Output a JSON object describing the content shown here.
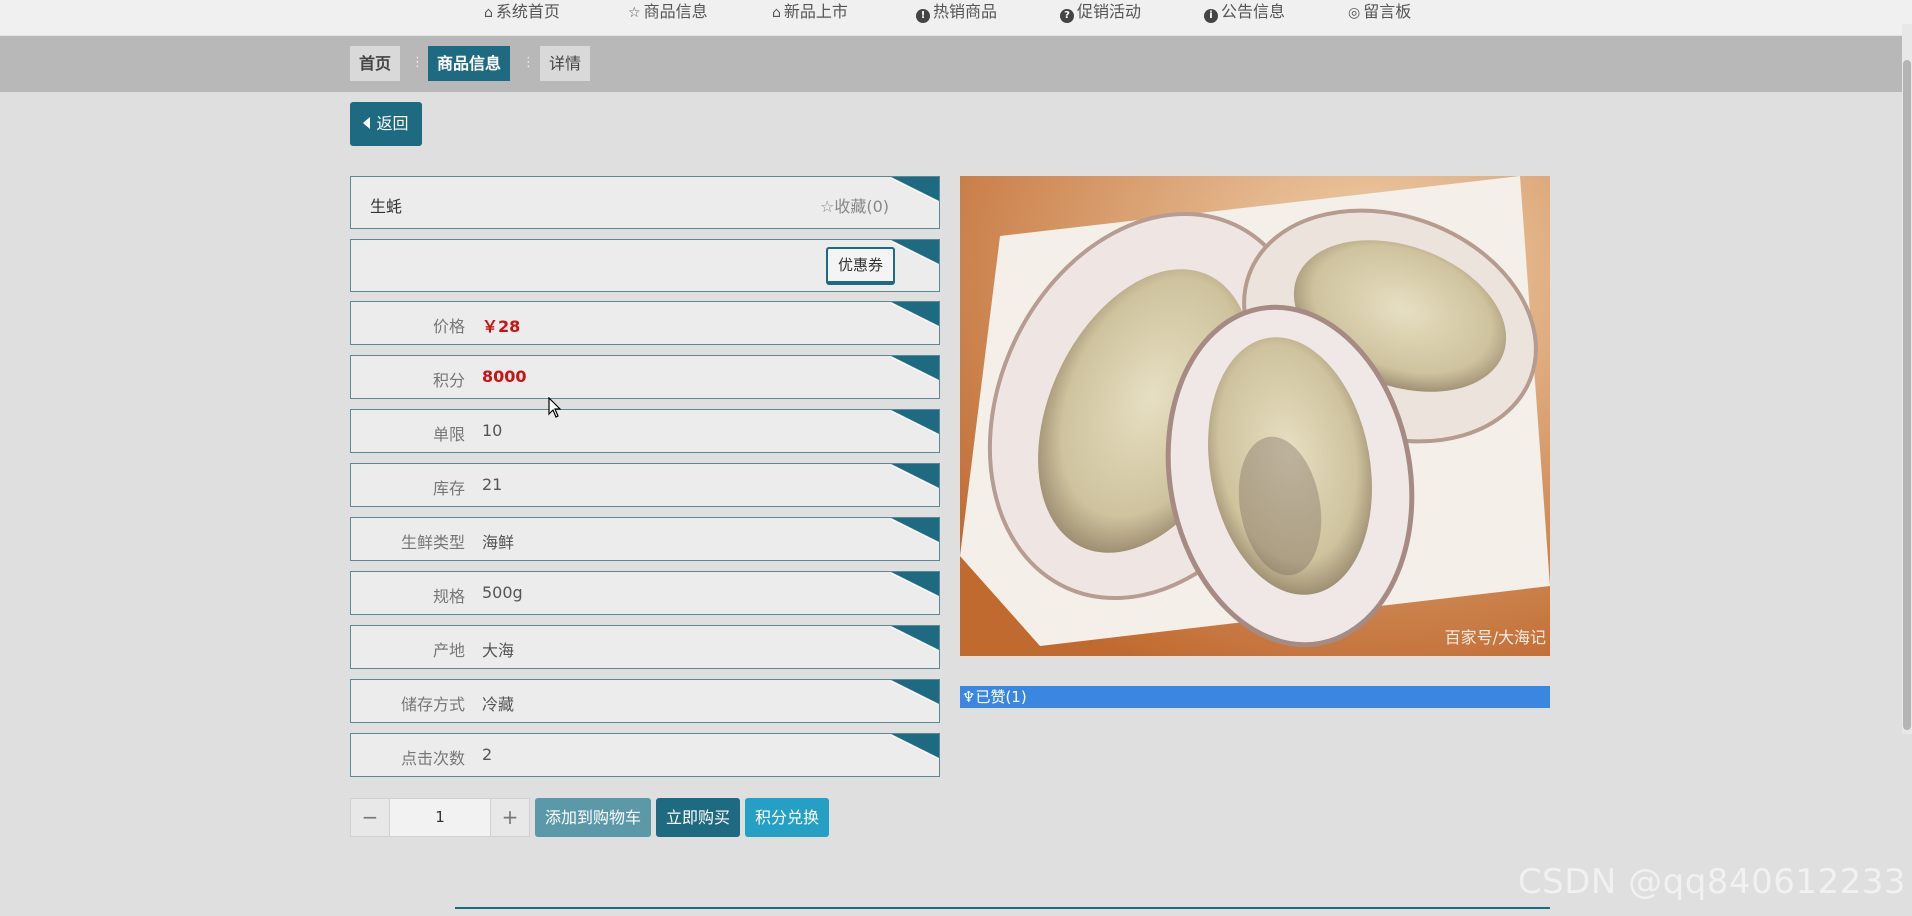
{
  "nav": {
    "items": [
      {
        "label": "系统首页",
        "icon": "home-icon"
      },
      {
        "label": "商品信息",
        "icon": "star-icon"
      },
      {
        "label": "新品上市",
        "icon": "bag-icon"
      },
      {
        "label": "热销商品",
        "icon": "exclamation-icon"
      },
      {
        "label": "促销活动",
        "icon": "question-icon"
      },
      {
        "label": "公告信息",
        "icon": "info-icon"
      },
      {
        "label": "留言板",
        "icon": "chat-icon"
      }
    ]
  },
  "breadcrumb": {
    "home": "首页",
    "current": "商品信息",
    "detail": "详情"
  },
  "back_label": "返回",
  "product": {
    "name": "生蚝",
    "favorite_label": "收藏(0)",
    "coupon_label": "优惠券",
    "fields": [
      {
        "label": "价格",
        "value": "￥28"
      },
      {
        "label": "积分",
        "value": "8000"
      },
      {
        "label": "单限",
        "value": "10"
      },
      {
        "label": "库存",
        "value": "21"
      },
      {
        "label": "生鲜类型",
        "value": "海鲜"
      },
      {
        "label": "规格",
        "value": "500g"
      },
      {
        "label": "产地",
        "value": "大海"
      },
      {
        "label": "储存方式",
        "value": "冷藏"
      },
      {
        "label": "点击次数",
        "value": "2"
      }
    ],
    "image_caption": "百家号/大海记",
    "liked_label": "已赞(1)"
  },
  "quantity": {
    "minus": "−",
    "value": "1",
    "plus": "+"
  },
  "actions": {
    "add_to_cart": "添加到购物车",
    "buy_now": "立即购买",
    "points_exchange": "积分兑换"
  },
  "watermark": "CSDN @qq840612233",
  "colors": {
    "primary": "#1e6a80",
    "price_red": "#cc1111",
    "like_blue": "#3a86e0",
    "cart_btn": "#5b99a8",
    "exchange_btn": "#23a0c4"
  }
}
